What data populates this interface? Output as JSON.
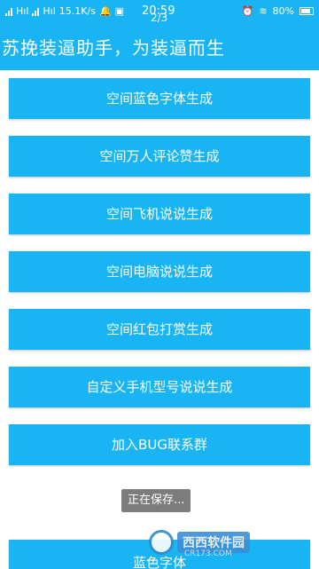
{
  "status_bar": {
    "carrier1": "Hıl",
    "carrier2": "Hıl",
    "speed": "15.1K/s",
    "time": "20:59",
    "page_indicator": "2/3",
    "battery": "80%"
  },
  "app_bar": {
    "title": "苏挽装逼助手，为装逼而生"
  },
  "buttons": [
    {
      "label": "空间蓝色字体生成"
    },
    {
      "label": "空间万人评论赞生成"
    },
    {
      "label": "空间飞机说说生成"
    },
    {
      "label": "空间电脑说说生成"
    },
    {
      "label": "空间红包打赏生成"
    },
    {
      "label": "自定义手机型号说说生成"
    },
    {
      "label": "加入BUG联系群"
    }
  ],
  "toast": {
    "text": "正在保存..."
  },
  "partial_button": {
    "label": "蓝色字体"
  },
  "watermark": {
    "brand": "西西软件园",
    "site": "CR173.COM"
  },
  "colors": {
    "primary": "#18b4f4",
    "text_on_primary": "#ffffff"
  }
}
